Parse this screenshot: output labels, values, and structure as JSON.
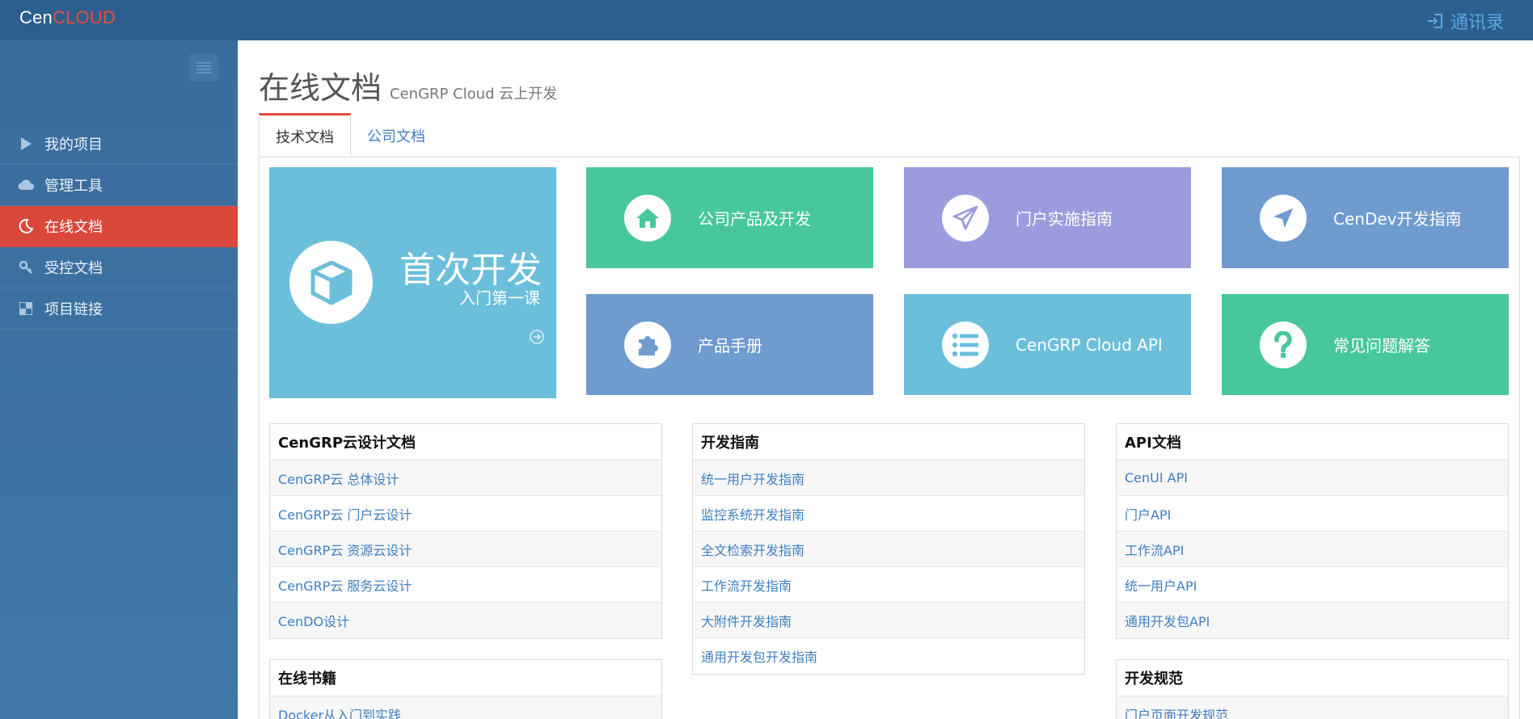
{
  "header": {
    "logo_prefix": "Cen",
    "logo_suffix": "CLOUD",
    "contacts_label": "通讯录"
  },
  "sidebar": {
    "items": [
      {
        "label": "我的项目",
        "icon": "play-icon"
      },
      {
        "label": "管理工具",
        "icon": "cloud-icon"
      },
      {
        "label": "在线文档",
        "icon": "moon-icon",
        "active": true
      },
      {
        "label": "受控文档",
        "icon": "key-icon"
      },
      {
        "label": "项目链接",
        "icon": "grid-icon"
      }
    ]
  },
  "page": {
    "title": "在线文档",
    "subtitle": "CenGRP Cloud 云上开发"
  },
  "tabs": [
    {
      "label": "技术文档",
      "active": true
    },
    {
      "label": "公司文档",
      "active": false
    }
  ],
  "hero": {
    "title": "首次开发",
    "subtitle": "入门第一课",
    "icon": "cube-icon",
    "color": "#6bbfdb"
  },
  "tiles": [
    {
      "label": "公司产品及开发",
      "icon": "home-icon",
      "color": "#48c89a"
    },
    {
      "label": "门户实施指南",
      "icon": "paper-plane-icon",
      "color": "#9b9cde"
    },
    {
      "label": "CenDev开发指南",
      "icon": "location-arrow-icon",
      "color": "#6f9bcf"
    },
    {
      "label": "产品手册",
      "icon": "puzzle-icon",
      "color": "#6f9bcf"
    },
    {
      "label": "CenGRP Cloud API",
      "icon": "list-icon",
      "color": "#6bbfdb"
    },
    {
      "label": "常见问题解答",
      "icon": "question-icon",
      "color": "#48c89a"
    }
  ],
  "panels": {
    "design": {
      "title": "CenGRP云设计文档",
      "items": [
        "CenGRP云 总体设计",
        "CenGRP云 门户云设计",
        "CenGRP云 资源云设计",
        "CenGRP云 服务云设计",
        "CenDO设计"
      ]
    },
    "guides": {
      "title": "开发指南",
      "items": [
        "统一用户开发指南",
        "监控系统开发指南",
        "全文检索开发指南",
        "工作流开发指南",
        "大附件开发指南",
        "通用开发包开发指南"
      ]
    },
    "api": {
      "title": "API文档",
      "items": [
        "CenUI API",
        "门户API",
        "工作流API",
        "统一用户API",
        "通用开发包API"
      ]
    },
    "books": {
      "title": "在线书籍",
      "items": [
        "Docker从入门到实践"
      ]
    },
    "standards": {
      "title": "开发规范",
      "items": [
        "门户页面开发规范"
      ]
    }
  }
}
